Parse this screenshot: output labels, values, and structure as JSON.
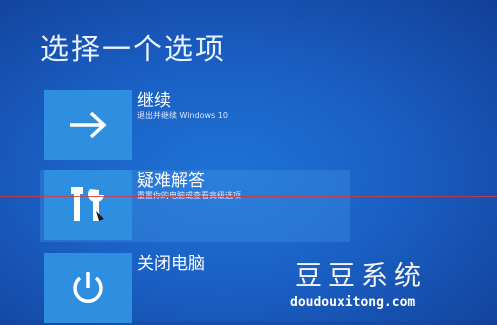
{
  "screen": {
    "title": "选择一个选项"
  },
  "options": [
    {
      "label": "继续",
      "description": "退出并继续 Windows 10",
      "icon": "arrow-right-icon"
    },
    {
      "label": "疑难解答",
      "description": "重置你的电脑或查看高级选项",
      "icon": "tools-icon"
    },
    {
      "label": "关闭电脑",
      "description": "",
      "icon": "power-icon"
    }
  ],
  "watermark": {
    "text": "豆豆系统",
    "url": "doudouxitong.com"
  },
  "colors": {
    "background": "#1a5fc4",
    "tile": "#2e8fe0",
    "highlight": "#4696e6",
    "line": "#d33a3a"
  }
}
